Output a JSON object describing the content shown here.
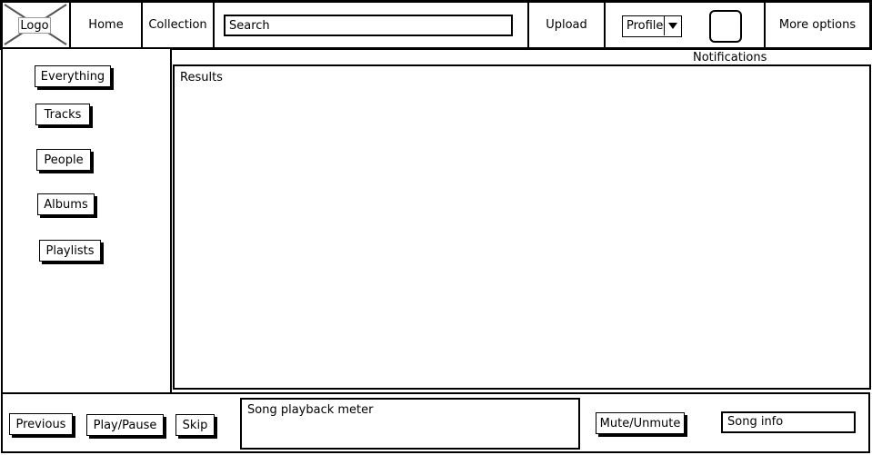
{
  "header": {
    "logo": "Logo",
    "nav": {
      "home": "Home",
      "collection": "Collection"
    },
    "search": {
      "value": "Search"
    },
    "upload": "Upload",
    "profile": "Profile",
    "notifications": "Notifications",
    "more_options": "More options"
  },
  "sidebar": {
    "filters": [
      "Everything",
      "Tracks",
      "People",
      "Albums",
      "Playlists"
    ]
  },
  "main": {
    "results_label": "Results"
  },
  "player": {
    "previous": "Previous",
    "play_pause": "Play/Pause",
    "skip": "Skip",
    "meter_label": "Song playback meter",
    "mute": "Mute/Unmute",
    "song_info": "Song info"
  }
}
